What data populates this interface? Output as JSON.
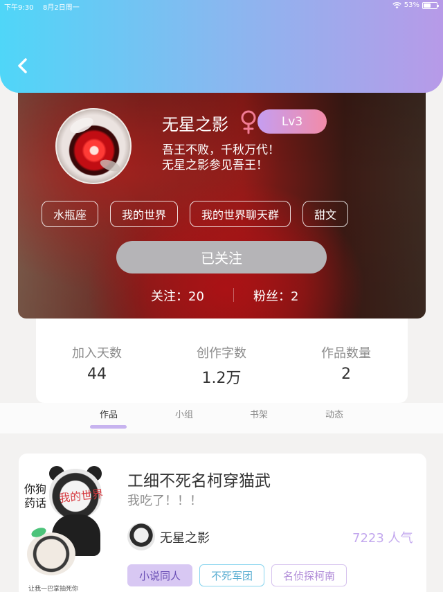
{
  "status_bar": {
    "time": "下午9:30",
    "date": "8月2日周一",
    "battery": "53%",
    "icons": [
      "wifi-icon",
      "battery-icon"
    ]
  },
  "header": {
    "back_icon": "chevron-left-icon",
    "gradient_colors": [
      "#4fd6f8",
      "#b79ae8"
    ]
  },
  "profile": {
    "name": "无星之影",
    "gender_icon": "female-symbol-icon",
    "level": "Lv3",
    "bio_lines": [
      "吾王不败，千秋万代！",
      "无星之影参见吾王！"
    ],
    "tags": [
      "水瓶座",
      "我的世界",
      "我的世界聊天群",
      "甜文"
    ],
    "follow_button": "已关注",
    "following": "关注：20",
    "fans": "粉丝：2"
  },
  "stats": [
    {
      "label": "加入天数",
      "value": "44"
    },
    {
      "label": "创作字数",
      "value": "1.2万"
    },
    {
      "label": "作品数量",
      "value": "2"
    }
  ],
  "tabs": [
    {
      "label": "作品",
      "active": true
    },
    {
      "label": "小组",
      "active": false
    },
    {
      "label": "书架",
      "active": false
    },
    {
      "label": "动态",
      "active": false
    }
  ],
  "work": {
    "title": "工细不死名柯穿猫武",
    "description": "我吃了！！！",
    "author": "无星之影",
    "popularity": "7223 人气",
    "tags": [
      "小说同人",
      "不死军团",
      "名侦探柯南"
    ],
    "cover_text": {
      "left": "你狗\n药话",
      "overlay": "我的世界",
      "caption": "让我一巴掌抽死你"
    }
  },
  "colors": {
    "accent_purple": "#c3a8ee",
    "level_badge": [
      "#c59ef1",
      "#f28ba8"
    ],
    "follow_button_bg": "#b5b4b7"
  }
}
